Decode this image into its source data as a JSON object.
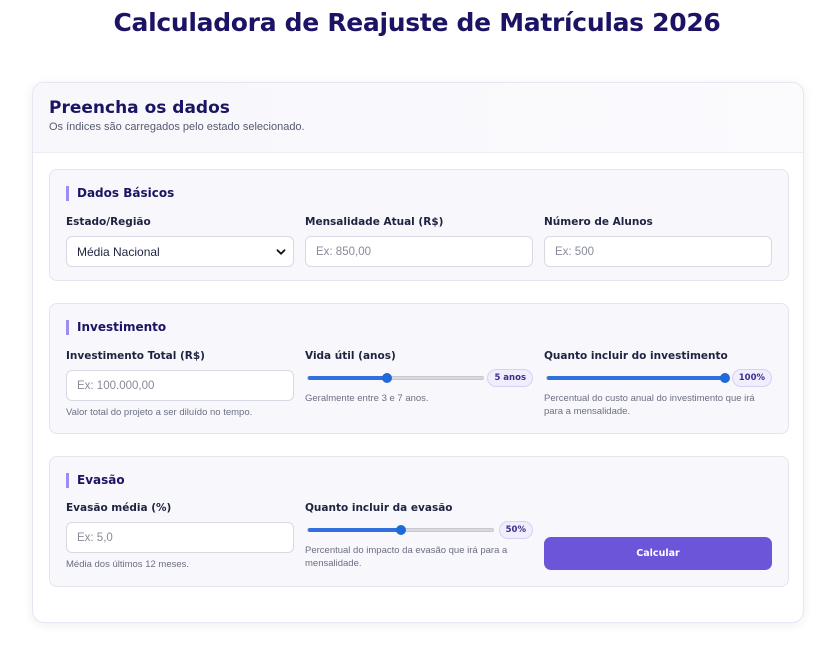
{
  "page": {
    "title": "Calculadora de Reajuste de Matrículas 2026"
  },
  "form": {
    "title": "Preencha os dados",
    "subtitle": "Os índices são carregados pelo estado selecionado."
  },
  "basic": {
    "title": "Dados Básicos",
    "estado": {
      "label": "Estado/Região",
      "value": "Média Nacional"
    },
    "mensalidade": {
      "label": "Mensalidade Atual (R$)",
      "placeholder": "Ex: 850,00"
    },
    "alunos": {
      "label": "Número de Alunos",
      "placeholder": "Ex: 500"
    }
  },
  "investment": {
    "title": "Investimento",
    "total": {
      "label": "Investimento Total (R$)",
      "placeholder": "Ex: 100.000,00",
      "help": "Valor total do projeto a ser diluído no tempo."
    },
    "vida_util": {
      "label": "Vida útil (anos)",
      "badge": "5 anos",
      "fill_fraction": 0.45,
      "help": "Geralmente entre 3 e 7 anos."
    },
    "incluir": {
      "label": "Quanto incluir do investimento",
      "badge": "100%",
      "fill_fraction": 1.0,
      "help": "Percentual do custo anual do investimento que irá para a mensalidade."
    }
  },
  "evasion": {
    "title": "Evasão",
    "media": {
      "label": "Evasão média (%)",
      "placeholder": "Ex: 5,0",
      "help": "Média dos últimos 12 meses."
    },
    "incluir": {
      "label": "Quanto incluir da evasão",
      "badge": "50%",
      "fill_fraction": 0.5,
      "help": "Percentual do impacto da evasão que irá para a mensalidade."
    },
    "calculate_label": "Calcular"
  },
  "colors": {
    "accent": "#6c55d9",
    "title": "#1b1464",
    "slider": "#1f6ad8"
  },
  "icons": {
    "select_chevron": "chevron-down-icon"
  }
}
